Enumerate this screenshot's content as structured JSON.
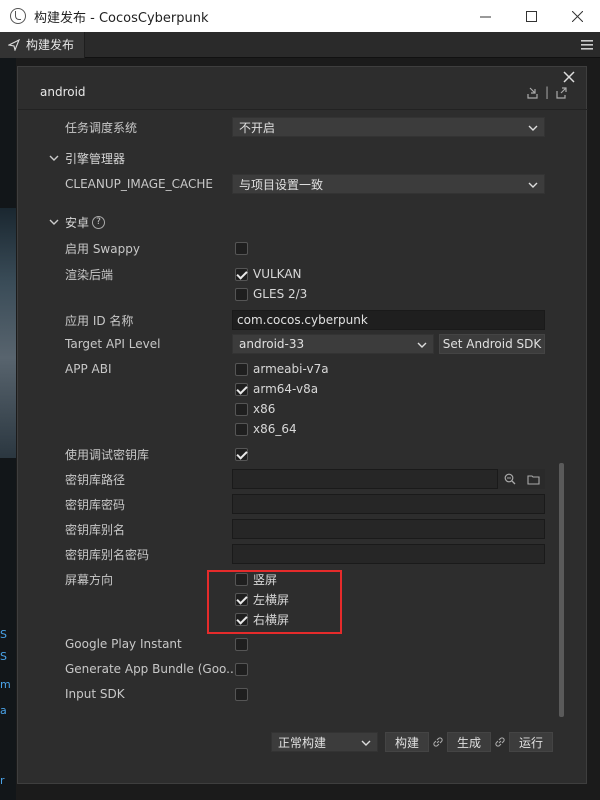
{
  "window": {
    "title": "构建发布 - CocosCyberpunk"
  },
  "tab": {
    "label": "构建发布"
  },
  "panel": {
    "platform": "android"
  },
  "fields": {
    "task_scheduler": {
      "label": "任务调度系统",
      "value": "不开启"
    },
    "engine_section": {
      "label": "引擎管理器"
    },
    "cleanup_cache": {
      "label": "CLEANUP_IMAGE_CACHE",
      "value": "与项目设置一致"
    },
    "android_section": {
      "label": "安卓",
      "help": "?"
    },
    "swappy": {
      "label": "启用 Swappy",
      "checked": false
    },
    "render_backend": {
      "label": "渲染后端",
      "options": [
        {
          "label": "VULKAN",
          "checked": true
        },
        {
          "label": "GLES 2/3",
          "checked": false
        }
      ]
    },
    "app_id": {
      "label": "应用 ID 名称",
      "value": "com.cocos.cyberpunk"
    },
    "target_api": {
      "label": "Target API Level",
      "value": "android-33",
      "sdk_button": "Set Android SDK"
    },
    "app_abi": {
      "label": "APP ABI",
      "options": [
        {
          "label": "armeabi-v7a",
          "checked": false
        },
        {
          "label": "arm64-v8a",
          "checked": true
        },
        {
          "label": "x86",
          "checked": false
        },
        {
          "label": "x86_64",
          "checked": false
        }
      ]
    },
    "debug_keystore": {
      "label": "使用调试密钥库",
      "checked": true
    },
    "keystore_path": {
      "label": "密钥库路径",
      "value": ""
    },
    "keystore_password": {
      "label": "密钥库密码",
      "value": ""
    },
    "keystore_alias": {
      "label": "密钥库别名",
      "value": ""
    },
    "keystore_alias_password": {
      "label": "密钥库别名密码",
      "value": ""
    },
    "orientation": {
      "label": "屏幕方向",
      "options": [
        {
          "label": "竖屏",
          "checked": false
        },
        {
          "label": "左横屏",
          "checked": true
        },
        {
          "label": "右横屏",
          "checked": true
        }
      ]
    },
    "google_play_instant": {
      "label": "Google Play Instant",
      "checked": false
    },
    "app_bundle": {
      "label": "Generate App Bundle (Goo...",
      "checked": false
    },
    "input_sdk": {
      "label": "Input SDK",
      "checked": false
    }
  },
  "footer": {
    "build_mode": "正常构建",
    "build_button": "构建",
    "make_button": "生成",
    "run_button": "运行"
  },
  "background": {
    "labels": [
      "S",
      "S",
      "m",
      "a",
      "r"
    ]
  },
  "colors": {
    "highlight_box": "#e52b2b",
    "panel_bg": "#2d2d2d"
  }
}
